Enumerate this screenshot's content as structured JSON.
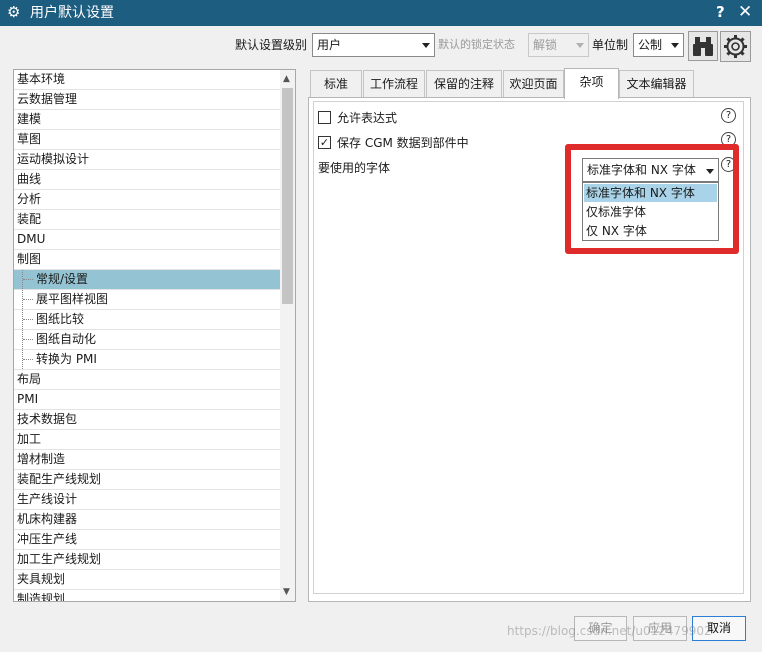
{
  "window": {
    "title": "用户默认设置",
    "icon": "gear-icon",
    "help_label": "?",
    "close_label": "✕"
  },
  "toolbar": {
    "level_label": "默认设置级别",
    "level_value": "用户",
    "lock_label": "默认的锁定状态",
    "lock_value": "解锁",
    "unit_label": "单位制",
    "unit_value": "公制",
    "find_icon": "binoculars-icon",
    "settings_icon": "gear-icon"
  },
  "tree": {
    "items": [
      {
        "label": "基本环境"
      },
      {
        "label": "云数据管理"
      },
      {
        "label": "建模"
      },
      {
        "label": "草图"
      },
      {
        "label": "运动模拟设计"
      },
      {
        "label": "曲线"
      },
      {
        "label": "分析"
      },
      {
        "label": "装配"
      },
      {
        "label": "DMU"
      },
      {
        "label": "制图"
      },
      {
        "label": "常规/设置"
      },
      {
        "label": "展平图样视图"
      },
      {
        "label": "图纸比较"
      },
      {
        "label": "图纸自动化"
      },
      {
        "label": "转换为 PMI"
      },
      {
        "label": "布局"
      },
      {
        "label": "PMI"
      },
      {
        "label": "技术数据包"
      },
      {
        "label": "加工"
      },
      {
        "label": "增材制造"
      },
      {
        "label": "装配生产线规划"
      },
      {
        "label": "生产线设计"
      },
      {
        "label": "机床构建器"
      },
      {
        "label": "冲压生产线"
      },
      {
        "label": "加工生产线规划"
      },
      {
        "label": "夹具规划"
      },
      {
        "label": "制造规划"
      }
    ],
    "selected": "常规/设置"
  },
  "tabs": [
    {
      "label": "标准"
    },
    {
      "label": "工作流程"
    },
    {
      "label": "保留的注释"
    },
    {
      "label": "欢迎页面"
    },
    {
      "label": "杂项"
    },
    {
      "label": "文本编辑器"
    }
  ],
  "active_tab": "杂项",
  "options": {
    "allow_expression": {
      "label": "允许表达式",
      "checked": false
    },
    "save_cgm": {
      "label": "保存 CGM 数据到部件中",
      "checked": true,
      "check_mark": "✓"
    },
    "font_label": "要使用的字体",
    "help_icon_text": "?",
    "font_value": "标准字体和 NX 字体",
    "font_options": [
      "标准字体和 NX 字体",
      "仅标准字体",
      "仅 NX 字体"
    ]
  },
  "buttons": {
    "ok": "确定",
    "apply": "应用",
    "cancel": "取消"
  },
  "watermark": "https://blog.csdn.net/u012479902",
  "colors": {
    "titlebar": "#1c5d80",
    "selection": "#94c4d3",
    "highlight_box": "#e02b2b",
    "dropdown_highlight": "#a9d3e8"
  }
}
